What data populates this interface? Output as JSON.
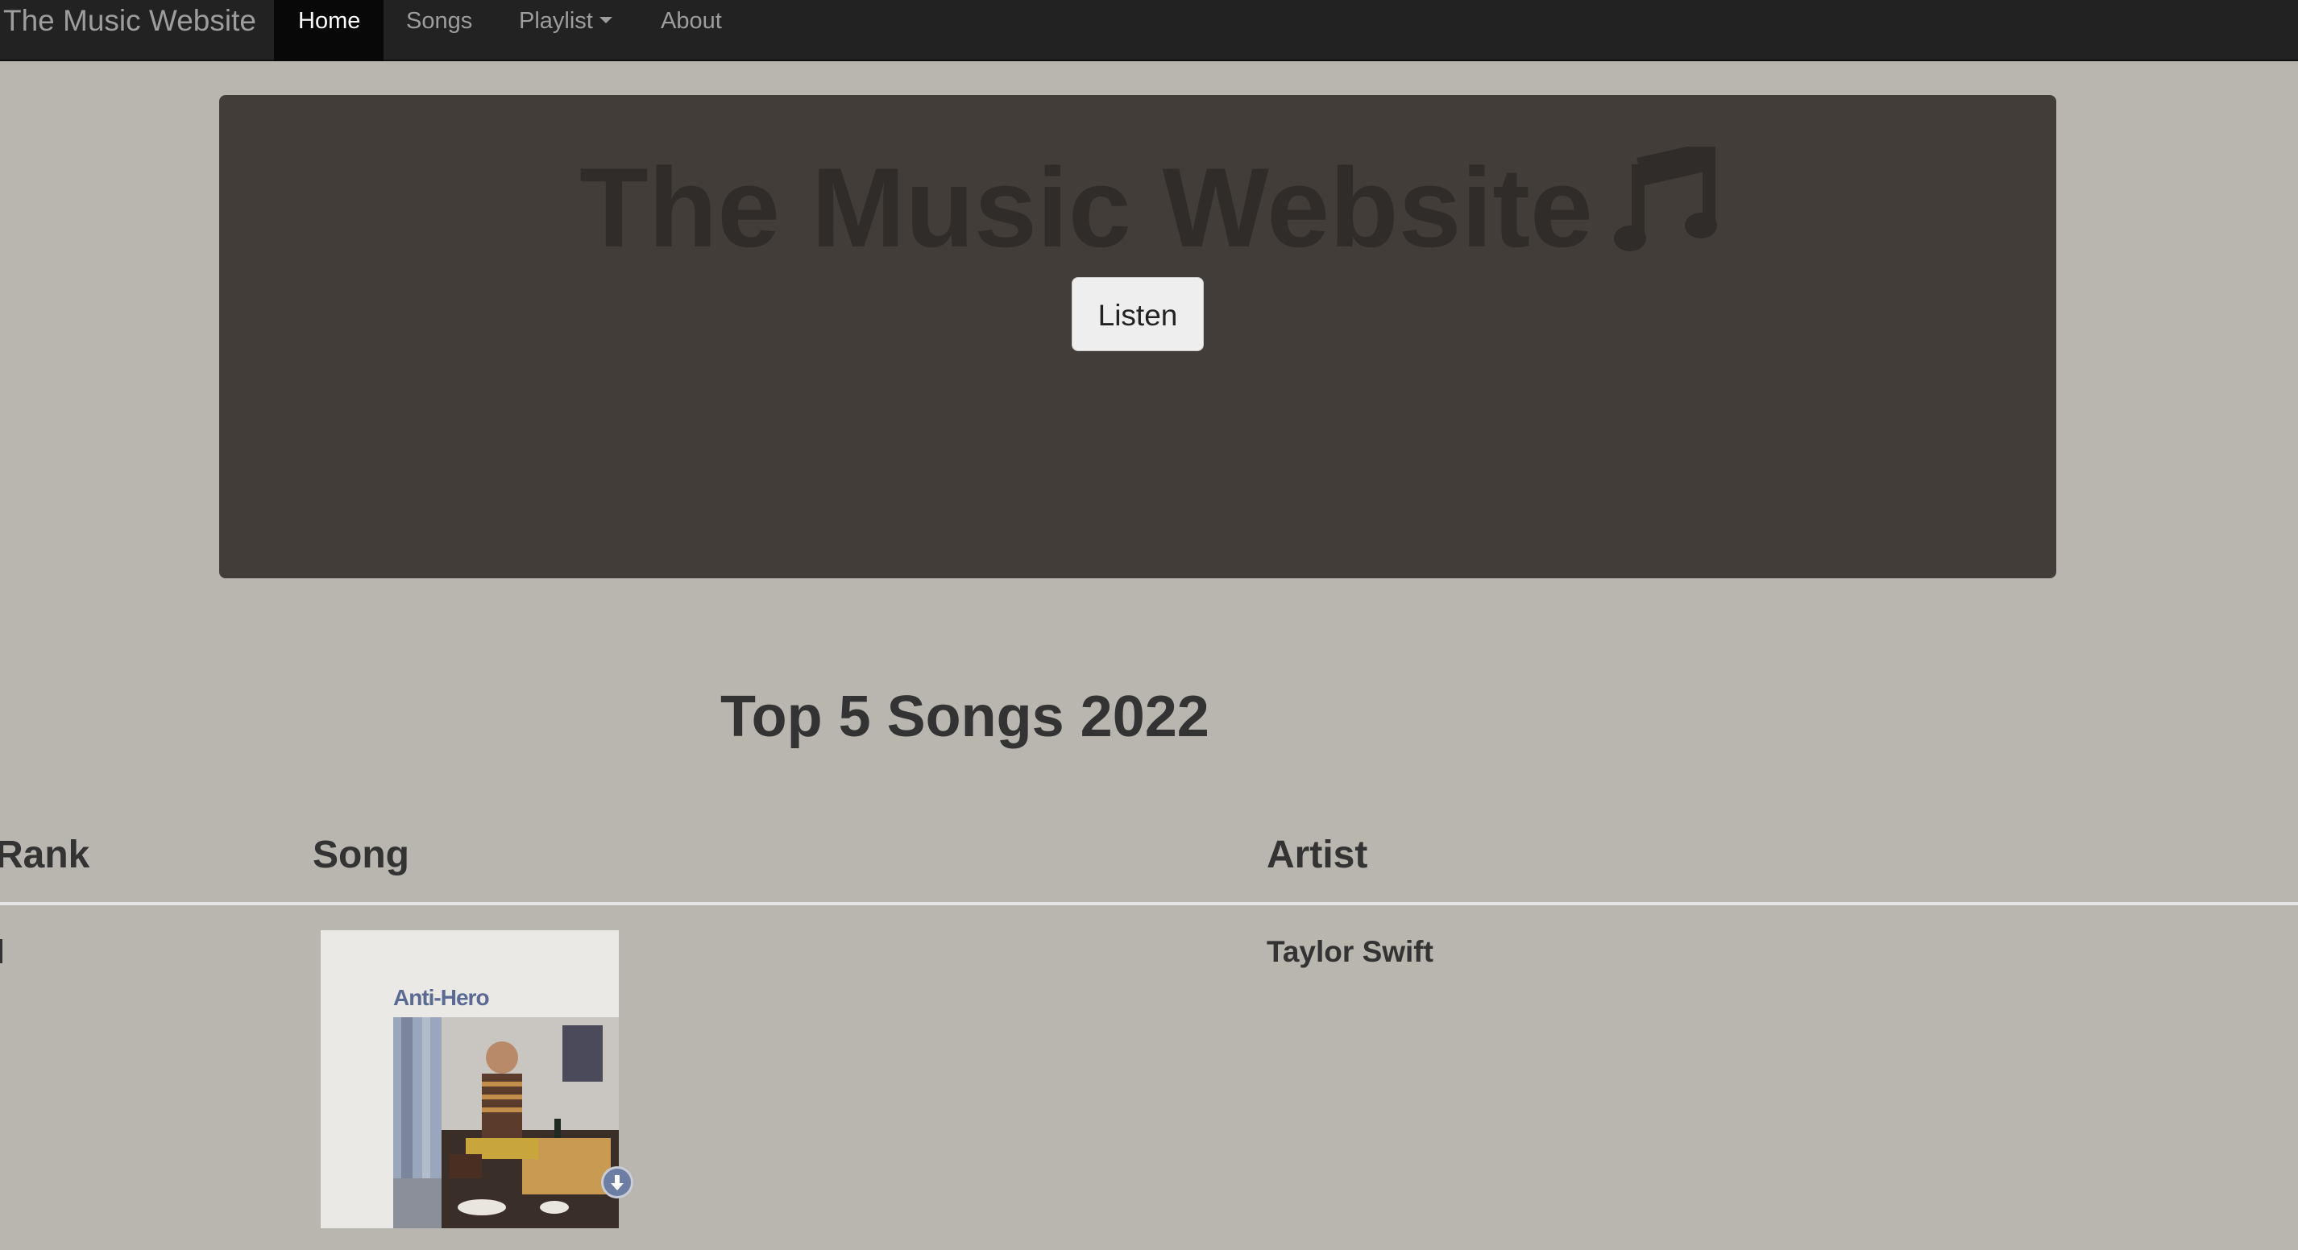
{
  "navbar": {
    "brand": "The Music Website",
    "items": [
      {
        "label": "Home",
        "active": true
      },
      {
        "label": "Songs",
        "active": false
      },
      {
        "label": "Playlist",
        "active": false,
        "dropdown": true
      },
      {
        "label": "About",
        "active": false
      }
    ]
  },
  "hero": {
    "title": "The Music Website",
    "icon": "music-note-icon",
    "button_label": "Listen"
  },
  "top_songs": {
    "heading": "Top 5 Songs 2022",
    "columns": [
      "Rank",
      "Song",
      "Artist"
    ],
    "rows": [
      {
        "rank": "",
        "song_art_title": "Anti-Hero",
        "artist": "Taylor Swift"
      }
    ]
  },
  "colors": {
    "navbar_bg": "#222222",
    "page_bg": "#b9b6b0",
    "hero_bg": "#423d39",
    "heading_text": "#333333"
  }
}
